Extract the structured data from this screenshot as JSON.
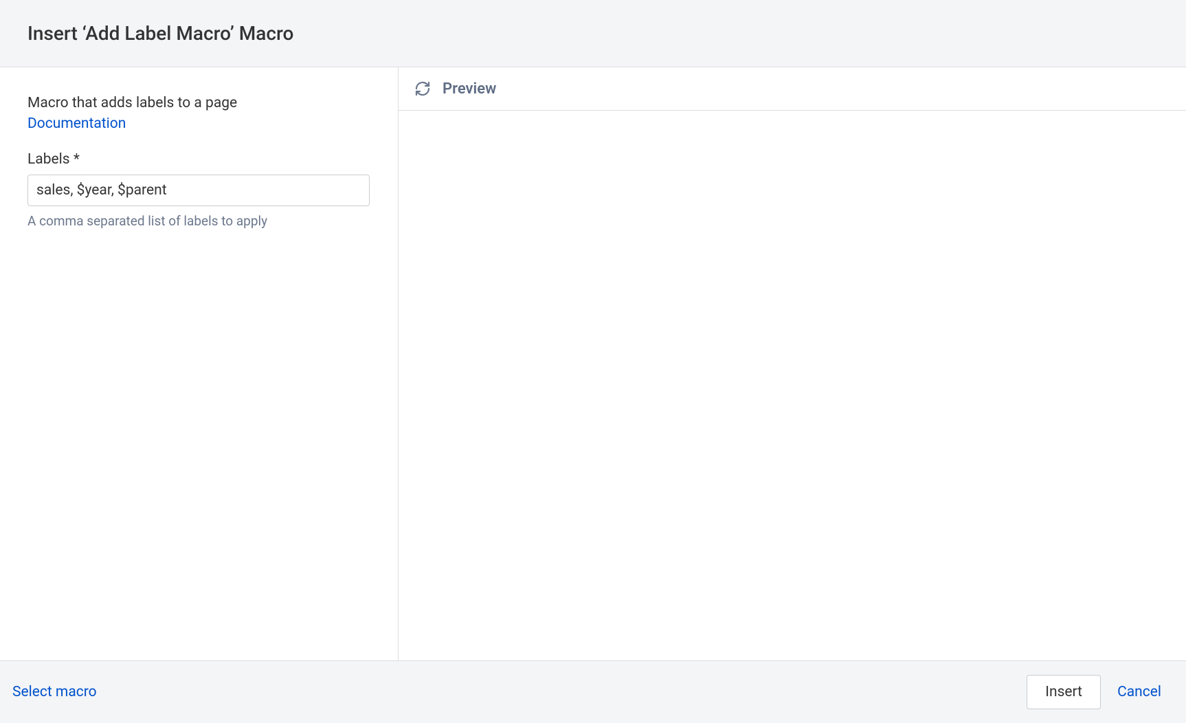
{
  "header": {
    "title": "Insert ‘Add Label Macro’ Macro"
  },
  "left": {
    "description": "Macro that adds labels to a page",
    "documentation_label": "Documentation",
    "field": {
      "label": "Labels *",
      "value": "sales, $year, $parent",
      "help": "A comma separated list of labels to apply"
    }
  },
  "right": {
    "preview_label": "Preview"
  },
  "footer": {
    "select_macro": "Select macro",
    "insert": "Insert",
    "cancel": "Cancel"
  }
}
